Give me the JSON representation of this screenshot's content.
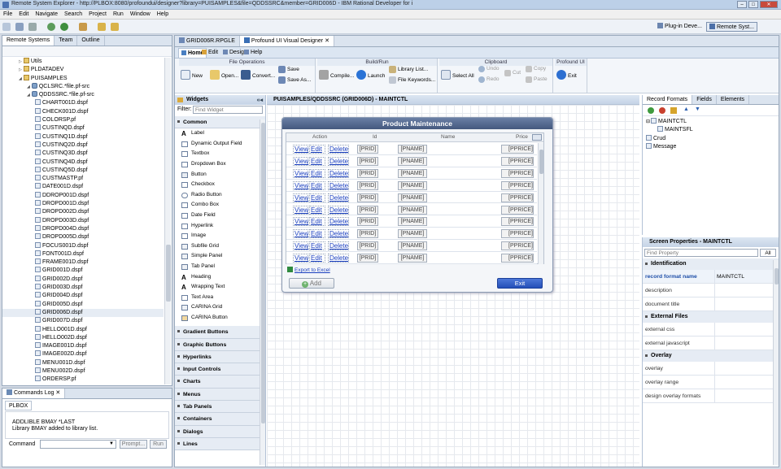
{
  "window": {
    "title": "Remote System Explorer - http://PLBOX:8080/profoundui/designer?library=PUISAMPLES&file=QDDSSRC&member=GRID006D - IBM Rational Developer for i"
  },
  "menu": [
    "File",
    "Edit",
    "Navigate",
    "Search",
    "Project",
    "Run",
    "Window",
    "Help"
  ],
  "toolbar_right": {
    "plugin": "Plug-in Deve...",
    "remote": "Remote Syst..."
  },
  "left_panel": {
    "tabs": [
      "Remote Systems",
      "Team",
      "Outline"
    ],
    "tree": [
      {
        "label": "Utils",
        "indent": 1,
        "icon": "folder"
      },
      {
        "label": "PLDATADEV",
        "indent": 1,
        "icon": "folder"
      },
      {
        "label": "PUISAMPLES",
        "indent": 1,
        "icon": "folder"
      },
      {
        "label": "QCLSRC.*file.pf-src",
        "indent": 2,
        "icon": "db"
      },
      {
        "label": "QDDSSRC.*file.pf-src",
        "indent": 2,
        "icon": "db"
      },
      {
        "label": "CHART001D.dspf",
        "indent": 3,
        "icon": "file"
      },
      {
        "label": "CHECK001D.dspf",
        "indent": 3,
        "icon": "file"
      },
      {
        "label": "COLORSP.pf",
        "indent": 3,
        "icon": "file"
      },
      {
        "label": "CUSTINQD.dspf",
        "indent": 3,
        "icon": "file"
      },
      {
        "label": "CUSTINQ1D.dspf",
        "indent": 3,
        "icon": "file"
      },
      {
        "label": "CUSTINQ2D.dspf",
        "indent": 3,
        "icon": "file"
      },
      {
        "label": "CUSTINQ3D.dspf",
        "indent": 3,
        "icon": "file"
      },
      {
        "label": "CUSTINQ4D.dspf",
        "indent": 3,
        "icon": "file"
      },
      {
        "label": "CUSTINQ5D.dspf",
        "indent": 3,
        "icon": "file"
      },
      {
        "label": "CUSTMASTP.pf",
        "indent": 3,
        "icon": "file"
      },
      {
        "label": "DATE001D.dspf",
        "indent": 3,
        "icon": "file"
      },
      {
        "label": "DDROP001D.dspf",
        "indent": 3,
        "icon": "file"
      },
      {
        "label": "DROPD001D.dspf",
        "indent": 3,
        "icon": "file"
      },
      {
        "label": "DROPD002D.dspf",
        "indent": 3,
        "icon": "file"
      },
      {
        "label": "DROPD003D.dspf",
        "indent": 3,
        "icon": "file"
      },
      {
        "label": "DROPD004D.dspf",
        "indent": 3,
        "icon": "file"
      },
      {
        "label": "DROPD005D.dspf",
        "indent": 3,
        "icon": "file"
      },
      {
        "label": "FOCUS001D.dspf",
        "indent": 3,
        "icon": "file"
      },
      {
        "label": "FONT001D.dspf",
        "indent": 3,
        "icon": "file"
      },
      {
        "label": "FRAME001D.dspf",
        "indent": 3,
        "icon": "file"
      },
      {
        "label": "GRID001D.dspf",
        "indent": 3,
        "icon": "file"
      },
      {
        "label": "GRID002D.dspf",
        "indent": 3,
        "icon": "file"
      },
      {
        "label": "GRID003D.dspf",
        "indent": 3,
        "icon": "file"
      },
      {
        "label": "GRID004D.dspf",
        "indent": 3,
        "icon": "file"
      },
      {
        "label": "GRID005D.dspf",
        "indent": 3,
        "icon": "file"
      },
      {
        "label": "GRID006D.dspf",
        "indent": 3,
        "icon": "file"
      },
      {
        "label": "GRID007D.dspf",
        "indent": 3,
        "icon": "file"
      },
      {
        "label": "HELLO001D.dspf",
        "indent": 3,
        "icon": "file"
      },
      {
        "label": "HELLO002D.dspf",
        "indent": 3,
        "icon": "file"
      },
      {
        "label": "IMAGE001D.dspf",
        "indent": 3,
        "icon": "file"
      },
      {
        "label": "IMAGE002D.dspf",
        "indent": 3,
        "icon": "file"
      },
      {
        "label": "MENU001D.dspf",
        "indent": 3,
        "icon": "file"
      },
      {
        "label": "MENU002D.dspf",
        "indent": 3,
        "icon": "file"
      },
      {
        "label": "ORDERSP.pf",
        "indent": 3,
        "icon": "file"
      }
    ]
  },
  "commands": {
    "tab": "Commands Log",
    "subtab": "PLBOX",
    "lines": [
      "ADDLIBLE BMAY *LAST",
      "Library BMAY added to library list."
    ],
    "label": "Command",
    "prompt": "Prompt...",
    "run": "Run"
  },
  "editor_tabs": [
    "GRID006R.RPGLE",
    "Profound UI Visual Designer"
  ],
  "designer": {
    "tabs": [
      "Home",
      "Edit",
      "Design",
      "Help"
    ],
    "groups": [
      {
        "title": "File Operations",
        "buttons": [
          "New",
          "Open...",
          "Convert...",
          "Save",
          "Save As..."
        ]
      },
      {
        "title": "Build/Run",
        "buttons": [
          "Compile...",
          "Launch",
          "Library List...",
          "File Keywords..."
        ]
      },
      {
        "title": "Clipboard",
        "buttons": [
          "Select All",
          "Undo",
          "Redo",
          "Cut",
          "Copy",
          "Paste"
        ]
      },
      {
        "title": "Profound UI",
        "buttons": [
          "Exit"
        ]
      }
    ],
    "widgets_title": "Widgets",
    "filter_label": "Filter:",
    "filter_placeholder": "Find Widget",
    "common": "Common",
    "widgets": [
      "Label",
      "Dynamic Output Field",
      "Textbox",
      "Dropdown Box",
      "Button",
      "Checkbox",
      "Radio Button",
      "Combo Box",
      "Date Field",
      "Hyperlink",
      "Image",
      "Subfile Grid",
      "Simple Panel",
      "Tab Panel",
      "Heading",
      "Wrapping Text",
      "Text Area",
      "CARINA Grid",
      "CARINA Button"
    ],
    "categories": [
      "Gradient Buttons",
      "Graphic Buttons",
      "Hyperlinks",
      "Input Controls",
      "Charts",
      "Menus",
      "Tab Panels",
      "Containers",
      "Dialogs",
      "Lines"
    ],
    "canvas_title": "PUISAMPLES/QDDSSRC (GRID006D) - MAINTCTL"
  },
  "form": {
    "title": "Product Maintenance",
    "columns": [
      "Action",
      "Id",
      "Name",
      "Price"
    ],
    "row_links": [
      "View",
      "Edit",
      "Delete"
    ],
    "row_fields": [
      "[PRID]",
      "[PNAME]",
      "[PPRICE]"
    ],
    "row_count": 10,
    "export": "Export to Excel",
    "add": "Add",
    "exit": "Exit"
  },
  "record_formats": {
    "tabs": [
      "Record Formats",
      "Fields",
      "Elements"
    ],
    "items": [
      {
        "label": "MAINTCTL",
        "indent": 0
      },
      {
        "label": "MAINTSFL",
        "indent": 1
      },
      {
        "label": "Crud",
        "indent": 0
      },
      {
        "label": "Message",
        "indent": 0
      }
    ]
  },
  "properties": {
    "title": "Screen Properties - MAINTCTL",
    "find_placeholder": "Find Property",
    "scope": "All",
    "sections": [
      {
        "title": "Identification",
        "rows": [
          {
            "label": "record format name",
            "value": "MAINTCTL"
          },
          {
            "label": "description",
            "value": ""
          },
          {
            "label": "document title",
            "value": ""
          }
        ]
      },
      {
        "title": "External Files",
        "rows": [
          {
            "label": "external css",
            "value": ""
          },
          {
            "label": "external javascript",
            "value": ""
          }
        ]
      },
      {
        "title": "Overlay",
        "rows": [
          {
            "label": "overlay",
            "value": ""
          },
          {
            "label": "overlay range",
            "value": ""
          },
          {
            "label": "design overlay formats",
            "value": ""
          }
        ]
      }
    ]
  },
  "colors": {
    "accent": "#1f4fa8",
    "form_header": "#4a5f85",
    "exit_btn": "#2a57c7",
    "link": "#1a3fbf"
  }
}
